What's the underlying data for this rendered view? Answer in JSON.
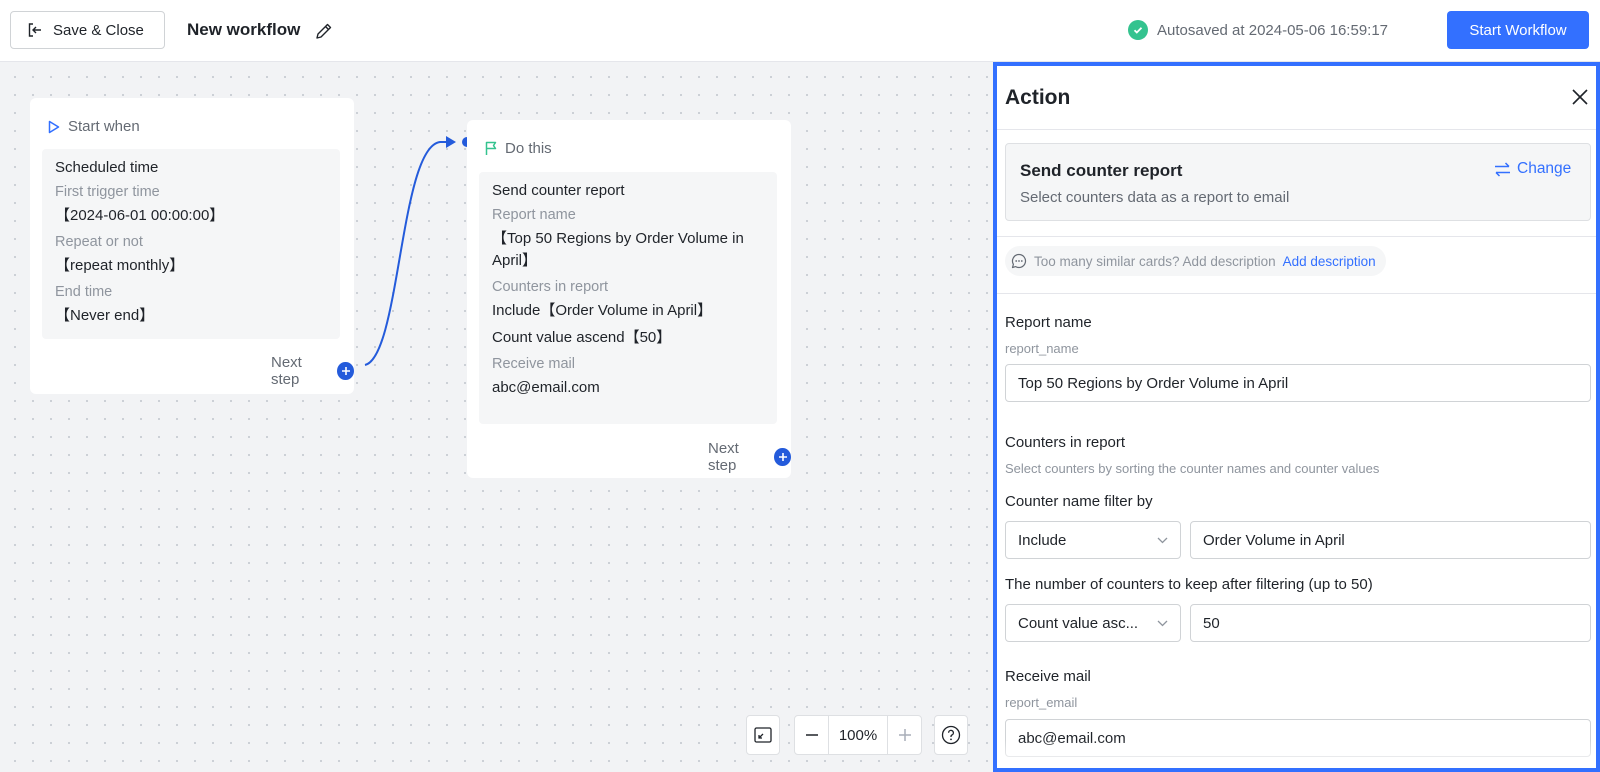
{
  "header": {
    "save_close_label": "Save & Close",
    "workflow_title": "New workflow",
    "autosave_text": "Autosaved at 2024-05-06 16:59:17",
    "start_button_label": "Start Workflow",
    "accent_color": "#3370ff"
  },
  "canvas": {
    "start_card": {
      "heading": "Start when",
      "title": "Scheduled time",
      "fields": [
        {
          "label": "First trigger time",
          "value": "【2024-06-01 00:00:00】"
        },
        {
          "label": "Repeat or not",
          "value": "【repeat monthly】"
        },
        {
          "label": "End time",
          "value": "【Never end】"
        }
      ],
      "next_step": "Next step"
    },
    "do_card": {
      "heading": "Do this",
      "title": "Send counter report",
      "report_name_label": "Report name",
      "report_name_value": "【Top 50 Regions by Order Volume in April】",
      "counters_label": "Counters in report",
      "counters_values": [
        "Include【Order Volume in April】",
        "Count value ascend【50】"
      ],
      "mail_label": "Receive mail",
      "mail_value": "abc@email.com",
      "next_step": "Next step"
    },
    "zoom": "100%"
  },
  "panel": {
    "title": "Action",
    "action": {
      "title": "Send counter report",
      "description": "Select counters data as a report to email",
      "change_label": "Change"
    },
    "hint": {
      "text": "Too many similar cards? Add description",
      "link": "Add description"
    },
    "report_name": {
      "label": "Report name",
      "variable": "report_name",
      "value": "Top 50 Regions by Order Volume in April"
    },
    "counters": {
      "label": "Counters in report",
      "description": "Select counters by sorting the counter names and counter values",
      "filter_label": "Counter name filter by",
      "filter_select": "Include",
      "filter_value": "Order Volume in April",
      "keep_label": "The number of counters to keep after filtering (up to 50)",
      "keep_select": "Count value asc...",
      "keep_value": "50"
    },
    "receive_mail": {
      "label": "Receive mail",
      "variable": "report_email",
      "value": "abc@email.com"
    }
  }
}
